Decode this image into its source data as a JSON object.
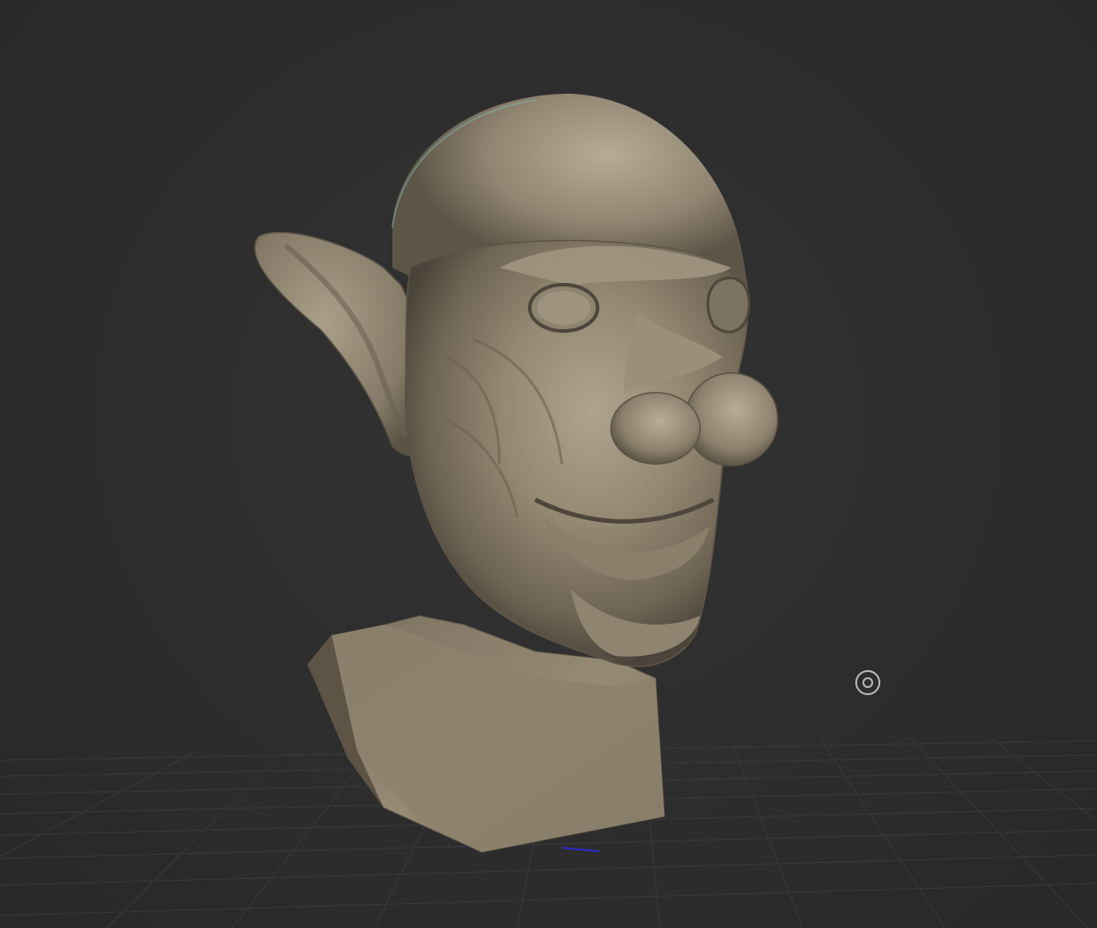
{
  "viewport": {
    "background_color": "#2c2c2c",
    "grid_color": "#3b3b3b",
    "grid_visible": true,
    "axis_marker_color": "#2a2ad0"
  },
  "model": {
    "type": "sculpt-bust-head",
    "material_color": "#8c8170",
    "highlight_color": "#b3a994",
    "shadow_color": "#4e463b",
    "rim_light_color": "#7fb3b0"
  },
  "gizmo": {
    "icon": "pivot-target-icon"
  }
}
